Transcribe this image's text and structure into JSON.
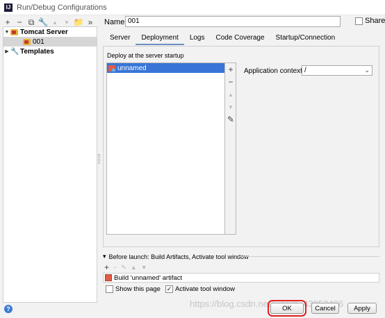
{
  "window": {
    "title": "Run/Debug Configurations",
    "app_icon_text": "IJ"
  },
  "left_toolbar": {
    "buttons": [
      {
        "icon": "plus-icon",
        "glyph": "+"
      },
      {
        "icon": "minus-icon",
        "glyph": "−"
      },
      {
        "icon": "copy-icon",
        "glyph": "⧉"
      },
      {
        "icon": "wrench-icon",
        "glyph": "🔧"
      },
      {
        "icon": "arrow-up-icon",
        "glyph": "▲"
      },
      {
        "icon": "arrow-down-icon",
        "glyph": "▼"
      },
      {
        "icon": "folder-icon",
        "glyph": "📁"
      },
      {
        "icon": "more-icon",
        "glyph": "»"
      }
    ]
  },
  "tree": {
    "items": [
      {
        "label": "Tomcat Server",
        "expanded": true,
        "bold": true
      },
      {
        "label": "001",
        "selected": true
      },
      {
        "label": "Templates",
        "expanded": false,
        "bold": true
      }
    ]
  },
  "form": {
    "name_label": "Name:",
    "name_value": "001",
    "share_label": "Share",
    "share_checked": false
  },
  "tabs": [
    "Server",
    "Deployment",
    "Logs",
    "Code Coverage",
    "Startup/Connection"
  ],
  "active_tab": "Deployment",
  "deployment": {
    "group_title": "Deploy at the server startup",
    "items": [
      "unnamed"
    ],
    "side_buttons": [
      "+",
      "−",
      "▲",
      "▼",
      "✎"
    ],
    "context_label": "Application context:",
    "context_value": "/"
  },
  "before_launch": {
    "title": "Before launch: Build Artifacts, Activate tool window",
    "toolbar": [
      "+",
      "−",
      "✎",
      "▲",
      "▼"
    ],
    "tasks": [
      "Build 'unnamed' artifact"
    ],
    "show_page_label": "Show this page",
    "show_page_checked": false,
    "activate_label": "Activate tool window",
    "activate_checked": true
  },
  "buttons": {
    "help": "?",
    "ok": "OK",
    "cancel": "Cancel",
    "apply": "Apply"
  },
  "watermark": "https://blog.csdn.net/weixin_43952406",
  "colors": {
    "selection": "#3875d7",
    "tab_underline": "#6b8fc4",
    "highlight": "#e02020"
  }
}
